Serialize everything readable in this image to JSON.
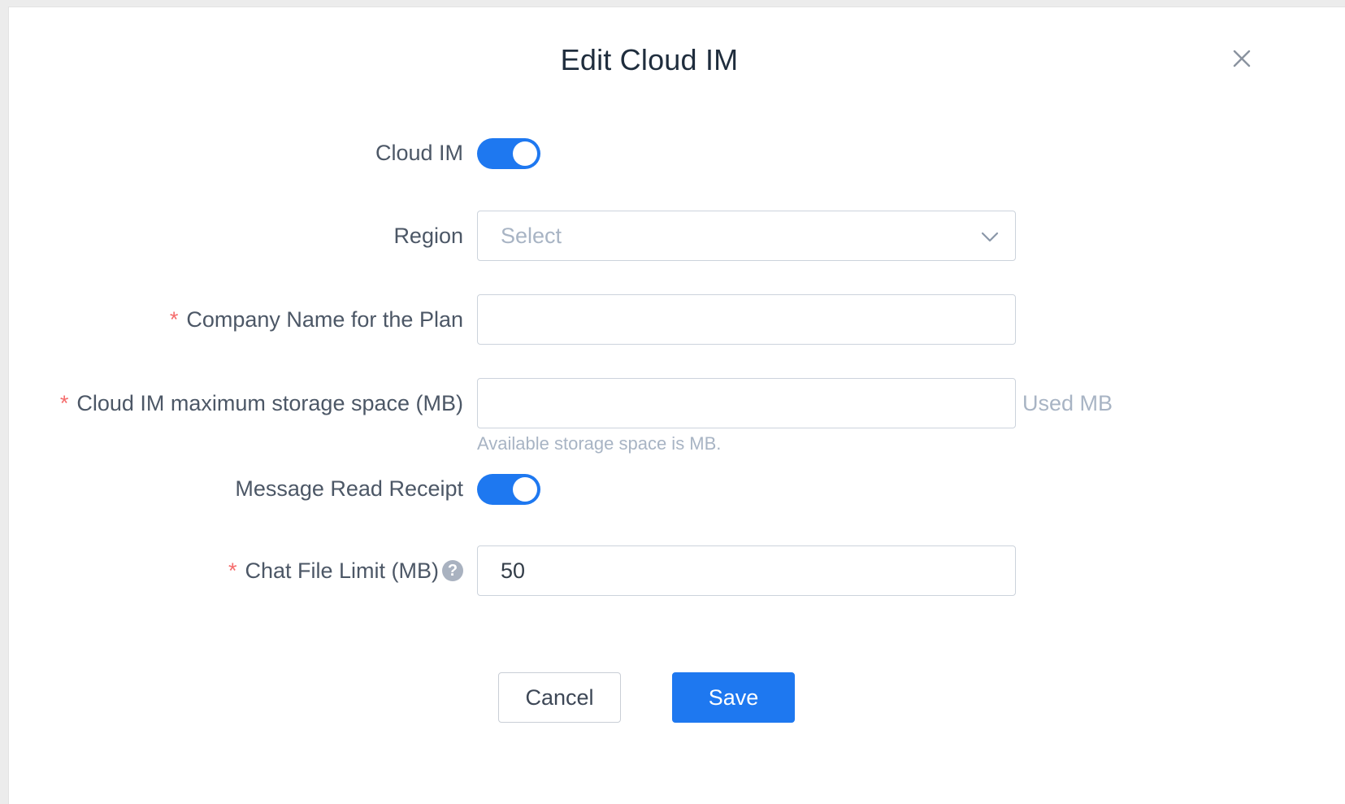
{
  "dialog": {
    "title": "Edit Cloud IM",
    "close_icon": "close-icon"
  },
  "form": {
    "cloud_im": {
      "label": "Cloud IM",
      "enabled": true
    },
    "region": {
      "label": "Region",
      "placeholder": "Select",
      "value": ""
    },
    "company_name": {
      "label": "Company Name for the Plan",
      "required_mark": "*",
      "value": ""
    },
    "max_storage": {
      "label": "Cloud IM maximum storage space (MB)",
      "required_mark": "*",
      "value": "",
      "suffix": "Used MB",
      "hint": "Available storage space is MB."
    },
    "read_receipt": {
      "label": "Message Read Receipt",
      "enabled": true
    },
    "chat_file_limit": {
      "label": "Chat File Limit (MB)",
      "required_mark": "*",
      "value": "50",
      "help_icon": "question-mark-icon",
      "help_glyph": "?"
    }
  },
  "buttons": {
    "cancel": "Cancel",
    "save": "Save"
  },
  "colors": {
    "accent": "#1e78f0",
    "required": "#f56c6c"
  }
}
